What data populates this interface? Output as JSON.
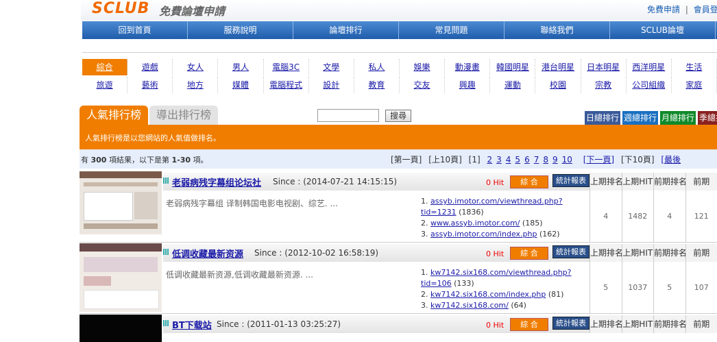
{
  "header": {
    "logo": "SCLUB",
    "logo_sub": "免費論壇申請",
    "link_register": "免費申請",
    "link_sep": "|",
    "link_login": "會員登"
  },
  "nav": [
    "回到首頁",
    "服務說明",
    "論壇排行",
    "常見問題",
    "聯絡我們",
    "SCLUB論壇"
  ],
  "categories_row1": [
    "綜合",
    "遊戲",
    "女人",
    "男人",
    "電腦3C",
    "文學",
    "私人",
    "娛樂",
    "動漫畫",
    "韓國明星",
    "港台明星",
    "日本明星",
    "西洋明星",
    "生活"
  ],
  "categories_row2": [
    "旅遊",
    "藝術",
    "地方",
    "媒體",
    "電腦程式",
    "設計",
    "教育",
    "交友",
    "興趣",
    "運動",
    "校園",
    "宗教",
    "公司組織",
    "家庭"
  ],
  "tabs": {
    "popular": "人氣排行榜",
    "export": "導出排行榜"
  },
  "search": {
    "button": "搜尋",
    "value": ""
  },
  "rank_buttons": [
    "日總排行",
    "週總排行",
    "月總排行",
    "季總排"
  ],
  "rank_colors": [
    "#3a5a9a",
    "#1a6fc0",
    "#0f8a2a",
    "#8a2020"
  ],
  "description": "人氣排行榜是以您網站的人氣值做排名。",
  "results": {
    "prefix": "有",
    "total": "300",
    "middle": "項結果，以下是第",
    "range": "1-30",
    "suffix": "項。"
  },
  "pager": {
    "first": "[第一頁]",
    "prev10": "[上10頁]",
    "current": "[1]",
    "pages": [
      "2",
      "3",
      "4",
      "5",
      "6",
      "7",
      "8",
      "9",
      "10"
    ],
    "next": "[下一頁]",
    "next10": "[下10頁]",
    "last": "[最後"
  },
  "entry_labels": {
    "combo": "綜 合",
    "stats": "統計報表",
    "hit_suffix": "Hit"
  },
  "stats_headers": [
    "上期排名",
    "上期HIT",
    "前期排名",
    "前期"
  ],
  "entries": [
    {
      "title": "老弱病残字幕组论坛社",
      "since": "Since : (2014-07-21 14:15:15)",
      "hit": "0",
      "description": "老弱病残字幕组 译制韩国电影电视剧、综艺. ...",
      "links": [
        {
          "num": "1.",
          "url": "assyb.imotor.com/viewthread.php?tid=1231",
          "count": "(1836)"
        },
        {
          "num": "2.",
          "url": "www.assyb.imotor.com/",
          "count": "(185)"
        },
        {
          "num": "3.",
          "url": "assyb.imotor.com/index.php",
          "count": "(162)"
        }
      ],
      "stats": [
        "4",
        "1482",
        "4",
        "121"
      ]
    },
    {
      "title": "低调收藏最新资源",
      "since": "Since : (2012-10-02 16:58:19)",
      "hit": "0",
      "description": "低调收藏最新资源,低调收藏最新资源. ...",
      "links": [
        {
          "num": "1.",
          "url": "kw7142.six168.com/viewthread.php?tid=106",
          "count": "(133)"
        },
        {
          "num": "2.",
          "url": "kw7142.six168.com/index.php",
          "count": "(81)"
        },
        {
          "num": "3.",
          "url": "kw7142.six168.com/",
          "count": "(64)"
        }
      ],
      "stats": [
        "5",
        "1037",
        "5",
        "107"
      ]
    },
    {
      "title": "BT下载站",
      "since": "Since : (2011-01-13 03:25:27)",
      "hit": "0"
    }
  ]
}
